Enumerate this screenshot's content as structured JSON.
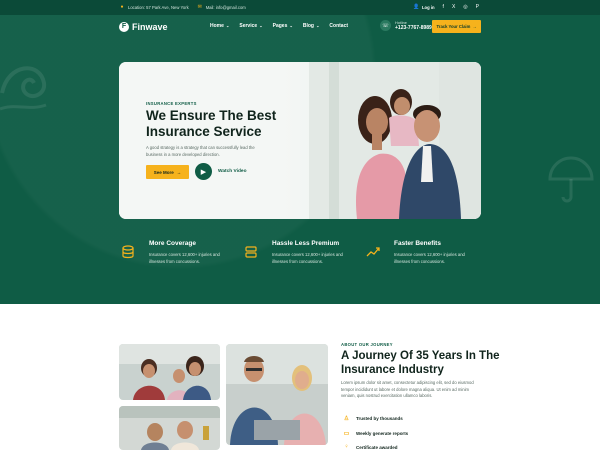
{
  "topbar": {
    "location": "Location: 57 Park Ave, New York",
    "mail": "Mail: info@gmail.com",
    "login": "Log in",
    "social": [
      "f",
      "X",
      "◎",
      "P"
    ]
  },
  "nav": {
    "brand": "Finwave",
    "menu": [
      "Home",
      "Service",
      "Pages",
      "Blog",
      "Contact"
    ],
    "hotline_label": "Hotline",
    "hotline_number": "+123-7767-8989",
    "track_button": "Track Your Claim"
  },
  "hero": {
    "kicker": "INSURANCE EXPERTS",
    "headline": "We Ensure The Best Insurance Service",
    "description": "A good strategy is a strategy that can successfully lead the business in a more developed direction.",
    "see_more": "See More",
    "watch_video": "Watch Video"
  },
  "features": [
    {
      "title": "More Coverage",
      "desc": "Insurance covers 12,600+ injuries and illnesses from concussions.",
      "icon": "database-icon"
    },
    {
      "title": "Hassle Less Premium",
      "desc": "Insurance covers 12,600+ injuries and illnesses from concussions.",
      "icon": "server-icon"
    },
    {
      "title": "Faster Benefits",
      "desc": "Insurance covers 12,600+ injuries and illnesses from concussions.",
      "icon": "trend-icon"
    }
  ],
  "about": {
    "kicker": "ABOUT OUR JOURNEY",
    "title": "A Journey Of 35 Years In The Insurance Industry",
    "description": "Lorem ipsum dolor sit amet, consectetur adipiscing elit, sed do eiusmod tempor incididunt ut labore et dolore magna aliqua. Ut enim ad minim veniam, quis nostrud exercitation ullamco laboris.",
    "bullets": [
      "Trusted by thousands",
      "Weekly generate reports",
      "Certificate awarded"
    ]
  },
  "colors": {
    "brand_green": "#0f5c45",
    "dark_green": "#0b4a38",
    "accent_yellow": "#f6b21c"
  }
}
